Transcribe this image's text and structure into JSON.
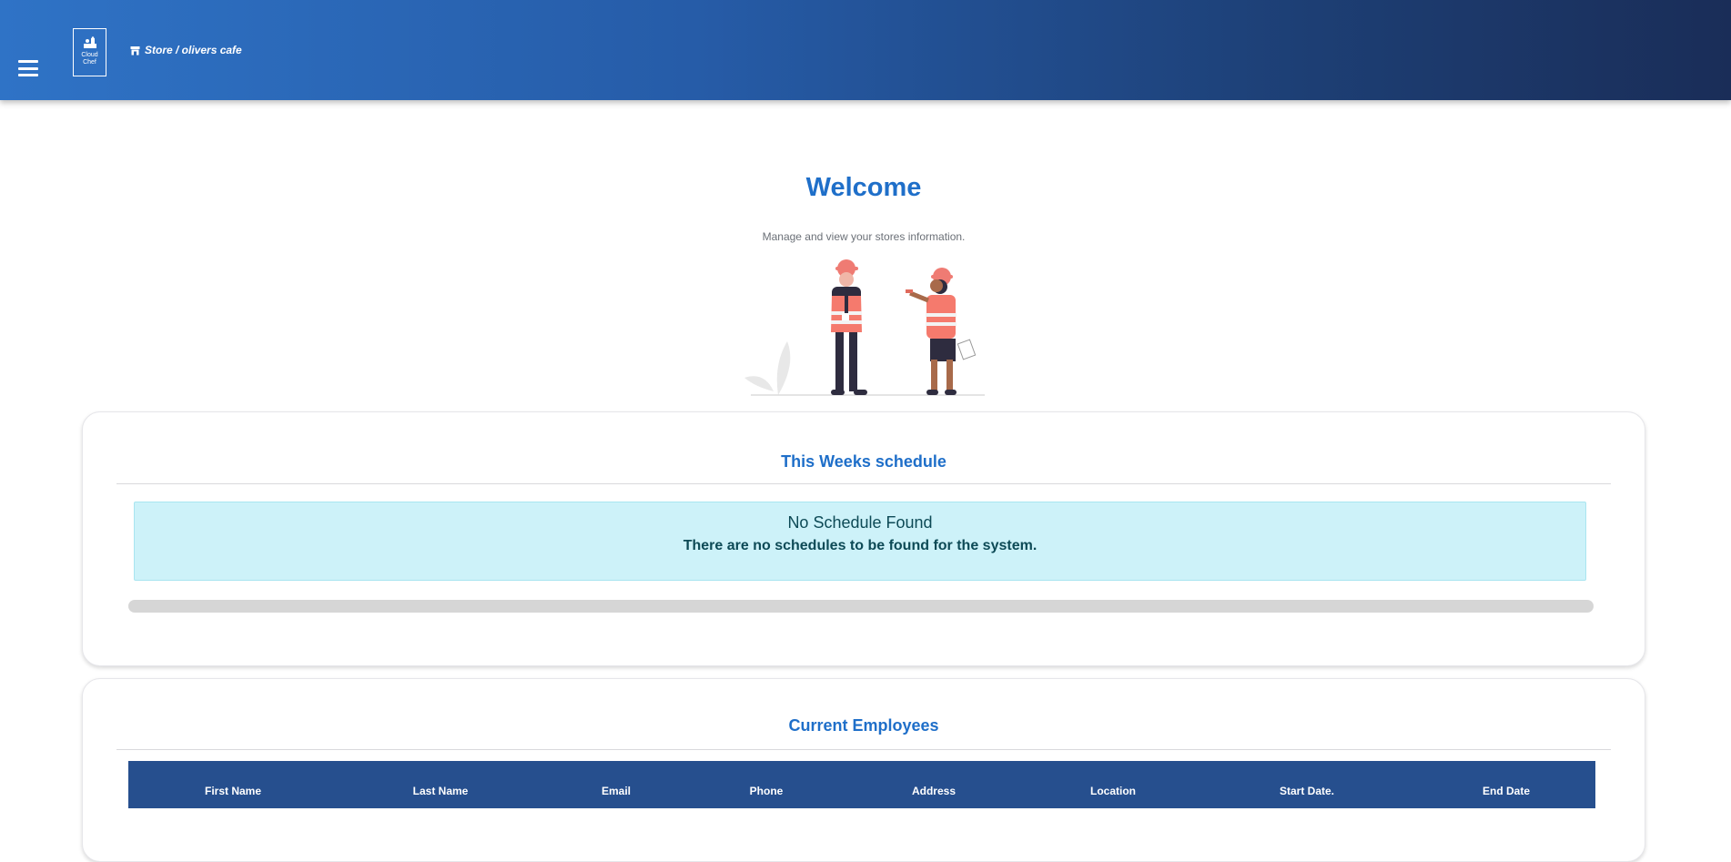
{
  "header": {
    "logo_line1": "Cloud",
    "logo_line2": "Chef",
    "store_path": "Store / olivers cafe"
  },
  "hero": {
    "title": "Welcome",
    "subtitle": "Manage and view your stores information."
  },
  "schedule": {
    "title": "This Weeks schedule",
    "alert_heading": "No Schedule Found",
    "alert_message": "There are no schedules to be found for the system."
  },
  "employees": {
    "title": "Current Employees",
    "columns": [
      "First Name",
      "Last Name",
      "Email",
      "Phone",
      "Address",
      "Location",
      "Start Date.",
      "End Date"
    ]
  },
  "colors": {
    "header_start": "#2f73c6",
    "header_end": "#1a2d58",
    "accent": "#1f6fc9",
    "alert_bg": "#cdf2f9",
    "table_header": "#264f8e"
  },
  "icons": [
    "menu-icon",
    "chef-logo-icon",
    "store-icon",
    "workers-illustration"
  ]
}
